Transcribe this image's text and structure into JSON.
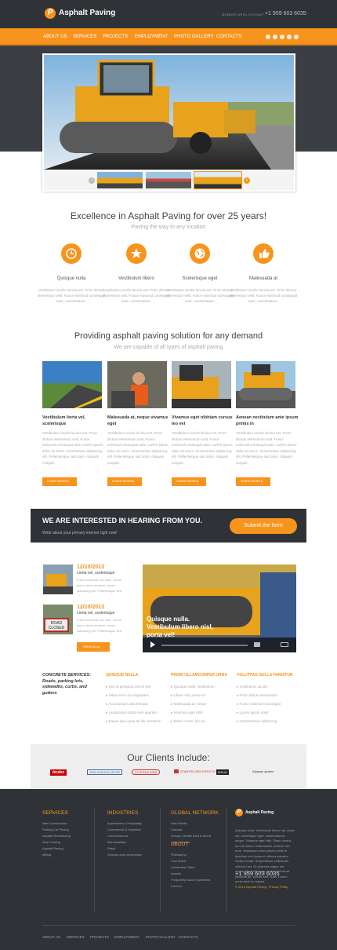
{
  "header": {
    "logo_mark": "P",
    "logo_text": "Asphalt Paving",
    "links": [
      "MEMBER AREA",
      "SITEMAP"
    ],
    "phone": "+1 959 603 6035"
  },
  "nav": {
    "items": [
      "ABOUT US",
      "SERVICES",
      "PROJECTS",
      "EMPLOYMENT",
      "PHOTO GALLERY",
      "CONTACTS"
    ],
    "social_icons": [
      "google-plus-icon",
      "twitter-icon",
      "facebook-icon",
      "pinterest-icon",
      "rss-icon"
    ]
  },
  "hero": {
    "title": "Excellence in Asphalt Paving for over 25 years!",
    "subtitle": "Paving the way to any location"
  },
  "features": [
    {
      "icon": "clock-icon",
      "title": "Quisque nulla",
      "text": "Vestibulum iaculis lacinia est. Proin dictum elementum velit. Fusce euismod consequat ante, consectetuer."
    },
    {
      "icon": "star-icon",
      "title": "Vestibulum libero",
      "text": "Vestibulum iaculis lacinia est. Proin dictum elementum velit. Fusce euismod consequat ante, consectetuer."
    },
    {
      "icon": "globe-icon",
      "title": "Scelerisque eget",
      "text": "Vestibulum iaculis lacinia est. Proin dictum elementum velit. Fusce euismod consequat ante, consectetuer."
    },
    {
      "icon": "thumbs-up-icon",
      "title": "Malesuada at",
      "text": "Vestibulum iaculis lacinia est. Proin dictum elementum velit. Fusce euismod consequat ante, consectetuer."
    }
  ],
  "section2": {
    "title": "Providing asphalt paving solution for any demand",
    "subtitle": "We are capable of all types of asphalt paving"
  },
  "cards": [
    {
      "title": "Vestibulum liorta vel, scelerisque",
      "text": "Vestibulum iaculis lacinia est. Proin dictum elementum velit. Fusce euismod consequat ante. Lorem ipsum dolor sit amet, consectetuer adipiscing elit. Pellentesque sed dolor. Aliquam congue.",
      "button": "LEARN MORE"
    },
    {
      "title": "Malesuada at, neque vivamus eget",
      "text": "Vestibulum iaculis lacinia est. Proin dictum elementum velit. Fusce euismod consequat ante. Lorem ipsum dolor sit amet, consectetuer adipiscing elit. Pellentesque sed dolor. Aliquam congue.",
      "button": "LEARN MORE"
    },
    {
      "title": "Vivamus eget nibhiam cursus leo vel",
      "text": "Vestibulum iaculis lacinia est. Proin dictum elementum velit. Fusce euismod consequat ante. Lorem ipsum dolor sit amet, consectetuer adipiscing elit. Pellentesque sed dolor. Aliquam congue.",
      "button": "LEARN MORE"
    },
    {
      "title": "Aenean necibulum ante ipsum primis in",
      "text": "Vestibulum iaculis lacinia est. Proin dictum elementum velit. Fusce euismod consequat ante. Lorem ipsum dolor sit amet, consectetuer adipiscing elit. Pellentesque sed dolor. Aliquam congue.",
      "button": "LEARN MORE"
    }
  ],
  "cta": {
    "title": "WE ARE INTERESTED IN HEARING FROM YOU.",
    "subtitle": "Write about your primary interest right now!",
    "button": "Submit the form"
  },
  "news": [
    {
      "date": "12/10/2013",
      "headline": "Liorta vel, scelerisque",
      "text": "Fusce euismod con ante. Lorem ipsum dolor sit amet, conse adipiscing elit. Pellentesque sed"
    },
    {
      "date": "12/10/2013",
      "headline": "Liorta vel, scelerisque",
      "text": "Fusce euismod con ante. Lorem ipsum dolor sit amet, conse adipiscing elit. Pellentesque sed"
    }
  ],
  "view_all": "VIEW ALL",
  "video": {
    "caption": "Quisque nulla. Vestibulum libero nisl, porta vel!"
  },
  "services": {
    "title": "CONCRETE SERVICES: Roads, parking lots, sidewalks, curbs, and gutters",
    "columns": [
      {
        "heading": "QUISQUE NULLA",
        "items": [
          "Sed ut perspicia omnis iste",
          "Natus error sit voluptatem",
          "Accusantium doloremque",
          "Laudantium totam rem aperiam",
          "Eaque ipsa quae ab illo inventore"
        ]
      },
      {
        "heading": "PROIN ULLAMCORPER URNA",
        "items": [
          "Quisque nulla. Vestibulum",
          "Libero nisl, porta vel",
          "Malesuada at, neque",
          "Vivamus eget nibh",
          "Etiam cursus leo vel"
        ]
      },
      {
        "heading": "VOLUTPAS NULLA PARIATUR",
        "items": [
          "Vestibulum iaculis",
          "Proin dictum elementum",
          "Fusce euismod consequat",
          "Lorem ipsum dolor",
          "Consectetuer adipiscing"
        ]
      }
    ]
  },
  "clients": {
    "title": "Our Clients Include:",
    "logos": [
      "brulex",
      "SKM KONSULTATOR",
      "ALTERNA WEB",
      "STANTED ARCHITECTS",
      "MSUU",
      "Aduwax sphere"
    ]
  },
  "footer": {
    "columns": [
      {
        "heading": "SERVICES",
        "items": [
          "New Construction",
          "Parking Lot Paving",
          "Asphalt Resurfacing",
          "Seal Coating",
          "Asphalt Paving",
          "Milling"
        ]
      },
      {
        "heading": "INDUSTRIES",
        "items": [
          "Apartments & Hospitality",
          "Commercial & Industrial",
          "Condominiums",
          "Municipalities",
          "Retail",
          "Schools and Universities"
        ]
      },
      {
        "heading": "GLOBAL NETWORK",
        "items": [
          "Asia Pacific",
          "Canada",
          "Europe, Middle East & Africa",
          "Latin America",
          "United States"
        ]
      },
      {
        "heading": "ABOUT",
        "items": [
          "Philosophy",
          "Fact Sheet",
          "Leadership Team",
          "Awards",
          "Frequently Asked Questions",
          "Careers"
        ]
      }
    ],
    "brand": "Asphalt Paving",
    "about_text": "Quisque nulla. Vestibulum libero nisl, porta vel, scelerisque eget, malesuada at, neque. Vivamus eget nibh. Etiam cursus leo vel metus. Nulla facilisi. Aenean nec eros. Vestibulum ante ipsum primis in faucibus orci luctus et ultrices posuere cubilia Curae; Suspendisse sollicitudin velit sed leo. Ut pharetra augue nec augue. Nam elit agna, endrerit sit amet, tincidunt ac, viverra sed, nulla. Donec porta diam eu massa.",
    "phone": "+1 959 603 6035",
    "copyright": "© 2013 Asphalt Paving. Privacy Policy",
    "bottom_links": [
      "ABOUT US",
      "SERVICES",
      "PROJECTS",
      "EMPLOYMENT",
      "PHOTO GALLERY",
      "CONTACTS"
    ]
  },
  "colors": {
    "accent": "#f7941d",
    "dark": "#2f3338"
  }
}
